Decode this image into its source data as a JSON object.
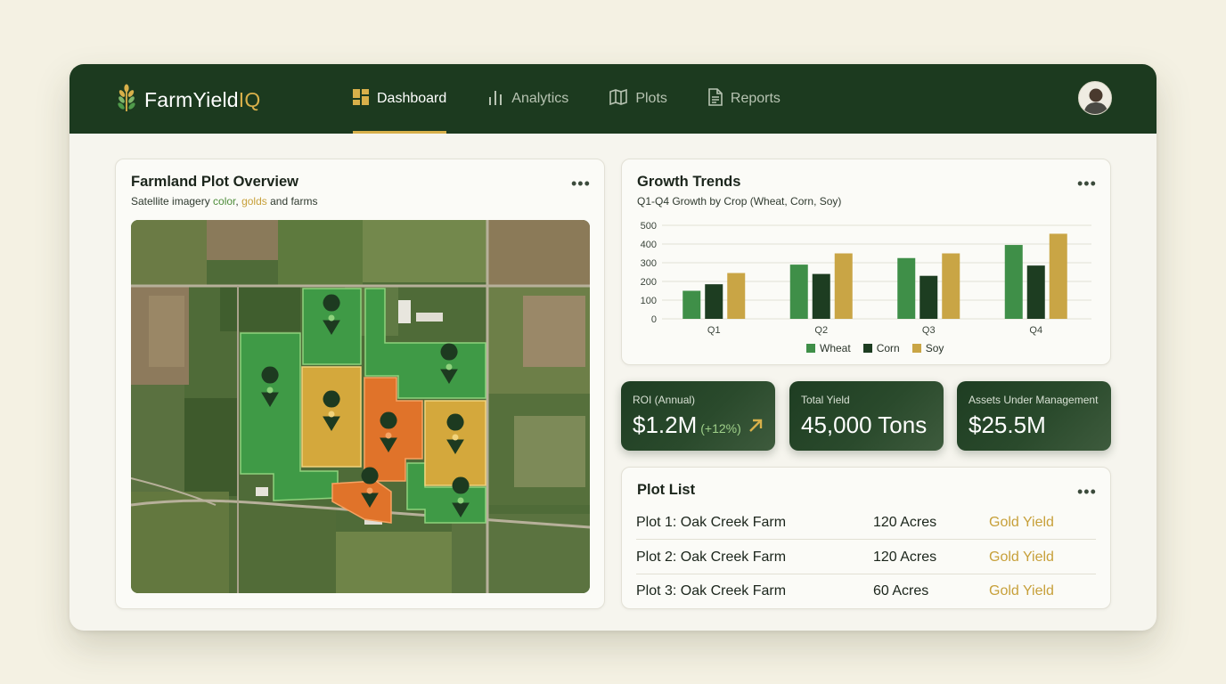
{
  "brand": {
    "name_prefix": "FarmYield",
    "name_suffix": "IQ"
  },
  "nav": {
    "items": [
      {
        "label": "Dashboard",
        "icon": "dashboard-grid-icon",
        "active": true
      },
      {
        "label": "Analytics",
        "icon": "bar-chart-icon",
        "active": false
      },
      {
        "label": "Plots",
        "icon": "map-icon",
        "active": false
      },
      {
        "label": "Reports",
        "icon": "document-icon",
        "active": false
      }
    ]
  },
  "overview": {
    "title": "Farmland Plot Overview",
    "sub_prefix": "Satellite imagery ",
    "sub_color": "color",
    "sub_sep": ", ",
    "sub_golds": "golds",
    "sub_suffix": " and farms"
  },
  "growth": {
    "title": "Growth Trends",
    "subtitle": "Q1-Q4 Growth by Crop (Wheat, Corn, Soy)"
  },
  "chart_data": {
    "type": "bar",
    "title": "Growth Trends",
    "subtitle": "Q1-Q4 Growth by Crop (Wheat, Corn, Soy)",
    "categories": [
      "Q1",
      "Q2",
      "Q3",
      "Q4"
    ],
    "series": [
      {
        "name": "Wheat",
        "color": "#3f8f48",
        "values": [
          150,
          290,
          325,
          395
        ]
      },
      {
        "name": "Corn",
        "color": "#1d3d21",
        "values": [
          185,
          240,
          230,
          285
        ]
      },
      {
        "name": "Soy",
        "color": "#c9a545",
        "values": [
          245,
          350,
          350,
          455
        ]
      }
    ],
    "yticks": [
      "0",
      "100",
      "200",
      "300",
      "400",
      "500"
    ],
    "ylim": [
      0,
      500
    ],
    "grid": true,
    "legend": "bottom-center"
  },
  "stats": [
    {
      "label": "ROI (Annual)",
      "value": "$1.2M",
      "delta": "(+12%)"
    },
    {
      "label": "Total Yield",
      "value": "45,000 Tons"
    },
    {
      "label": "Assets Under Management",
      "value": "$25.5M"
    }
  ],
  "plots": {
    "title": "Plot List",
    "rows": [
      {
        "name": "Plot 1: Oak Creek Farm",
        "acres": "120 Acres",
        "yield": "Gold Yield"
      },
      {
        "name": "Plot 2: Oak Creek Farm",
        "acres": "120 Acres",
        "yield": "Gold Yield"
      },
      {
        "name": "Plot 3: Oak Creek Farm",
        "acres": "60 Acres",
        "yield": "Gold Yield"
      }
    ]
  },
  "colors": {
    "header": "#1c3a1f",
    "accent_gold": "#d8b04a",
    "plot_green": "#3f9a46",
    "plot_gold": "#d4a83c",
    "plot_orange": "#e0732a"
  }
}
